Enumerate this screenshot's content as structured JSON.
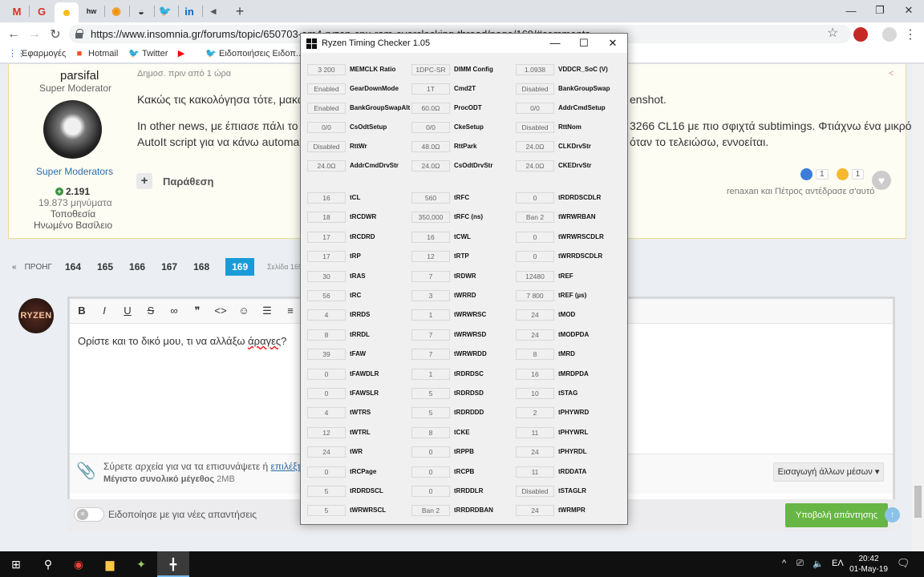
{
  "browser": {
    "url": "https://www.insomnia.gr/forums/topic/650703-am4-ryzen-cpu-ram-overclocking-thread/page/169/#comments",
    "bookmarks": [
      "Εφαρμογές",
      "Hotmail",
      "Twitter",
      "",
      "Ειδοποιήσεις Ειδοπ..."
    ]
  },
  "post": {
    "author": "parsifal",
    "role": "Super Moderator",
    "group": "Super Moderators",
    "reputation": "2.191",
    "posts": "19.873 μηνύματα",
    "location": "Τοποθεσία Ηνωμένο Βασίλειο",
    "date": "Δημοσ. πριν από 1 ώρα",
    "line1a": "Κακώς τις κακολόγησα τότε, μακάρ",
    "line1b": "enshot.",
    "line2a": "In other news, με έπιασε πάλι το μικ",
    "line2b": "3266 CL16 με πιο σφιχτά subtimings. Φτιάχνω ένα μικρό",
    "line3a": "AutoIt script για να κάνω automate p",
    "line3b": "όταν το τελειώσω, εννοείται.",
    "quote": "Παράθεση",
    "reaction1": "1",
    "reaction2": "1",
    "reacted_by": "renaxan και Πέτρος αντέδρασε σ'αυτό"
  },
  "pagination": {
    "prev": "ΠΡΟΗΓ",
    "pages": [
      "164",
      "165",
      "166",
      "167",
      "168"
    ],
    "current": "169",
    "info": "Σελίδα 169 απο"
  },
  "editor": {
    "avatar_text": "RYZEN",
    "text_before": "Ορίστε και το δικό μου, τι να αλλάξω ",
    "text_err": "άραγες",
    "text_after": "?",
    "attach_text": "Σύρετε αρχεία για να τα επισυνάψετε ή ",
    "attach_link": "επιλέξτε",
    "attach_max_label": "Μέγιστο συνολικό μέγεθος",
    "attach_max_value": "2MB",
    "media_button": "Εισαγωγή άλλων μέσων ▾",
    "notify": "Ειδοποίησε με για νέες απαντήσεις",
    "submit": "Υποβολή απάντησης"
  },
  "dialog": {
    "title": "Ryzen Timing Checker 1.05",
    "top": [
      [
        {
          "v": "3 200",
          "l": "MEMCLK Ratio"
        },
        {
          "v": "1DPC-SR",
          "l": "DIMM Config"
        },
        {
          "v": "1.0938",
          "l": "VDDCR_SoC (V)"
        }
      ],
      [
        {
          "v": "Enabled",
          "l": "GearDownMode"
        },
        {
          "v": "1T",
          "l": "Cmd2T"
        },
        {
          "v": "Disabled",
          "l": "BankGroupSwap"
        }
      ],
      [
        {
          "v": "Enabled",
          "l": "BankGroupSwapAlt"
        },
        {
          "v": "60.0Ω",
          "l": "ProcODT"
        },
        {
          "v": "0/0",
          "l": "AddrCmdSetup"
        }
      ],
      [
        {
          "v": "0/0",
          "l": "CsOdtSetup"
        },
        {
          "v": "0/0",
          "l": "CkeSetup"
        },
        {
          "v": "Disabled",
          "l": "RttNom"
        }
      ],
      [
        {
          "v": "Disabled",
          "l": "RttWr"
        },
        {
          "v": "48.0Ω",
          "l": "RttPark"
        },
        {
          "v": "24.0Ω",
          "l": "CLKDrvStr"
        }
      ],
      [
        {
          "v": "24.0Ω",
          "l": "AddrCmdDrvStr"
        },
        {
          "v": "24.0Ω",
          "l": "CsOdtDrvStr"
        },
        {
          "v": "24.0Ω",
          "l": "CKEDrvStr"
        }
      ]
    ],
    "timings": [
      [
        {
          "v": "16",
          "l": "tCL"
        },
        {
          "v": "560",
          "l": "tRFC"
        },
        {
          "v": "0",
          "l": "tRDRDSCDLR"
        }
      ],
      [
        {
          "v": "18",
          "l": "tRCDWR"
        },
        {
          "v": "350,000",
          "l": "tRFC (ns)"
        },
        {
          "v": "Ban 2",
          "l": "tWRWRBAN"
        }
      ],
      [
        {
          "v": "17",
          "l": "tRCDRD"
        },
        {
          "v": "16",
          "l": "tCWL"
        },
        {
          "v": "0",
          "l": "tWRWRSCDLR"
        }
      ],
      [
        {
          "v": "17",
          "l": "tRP"
        },
        {
          "v": "12",
          "l": "tRTP"
        },
        {
          "v": "0",
          "l": "tWRRDSCDLR"
        }
      ],
      [
        {
          "v": "30",
          "l": "tRAS"
        },
        {
          "v": "7",
          "l": "tRDWR"
        },
        {
          "v": "12480",
          "l": "tREF"
        }
      ],
      [
        {
          "v": "56",
          "l": "tRC"
        },
        {
          "v": "3",
          "l": "tWRRD"
        },
        {
          "v": "7 800",
          "l": "tREF (µs)"
        }
      ],
      [
        {
          "v": "4",
          "l": "tRRDS"
        },
        {
          "v": "1",
          "l": "tWRWRSC"
        },
        {
          "v": "24",
          "l": "tMOD"
        }
      ],
      [
        {
          "v": "8",
          "l": "tRRDL"
        },
        {
          "v": "7",
          "l": "tWRWRSD"
        },
        {
          "v": "24",
          "l": "tMODPDA"
        }
      ],
      [
        {
          "v": "39",
          "l": "tFAW"
        },
        {
          "v": "7",
          "l": "tWRWRDD"
        },
        {
          "v": "8",
          "l": "tMRD"
        }
      ],
      [
        {
          "v": "0",
          "l": "tFAWDLR"
        },
        {
          "v": "1",
          "l": "tRDRDSC"
        },
        {
          "v": "16",
          "l": "tMRDPDA"
        }
      ],
      [
        {
          "v": "0",
          "l": "tFAWSLR"
        },
        {
          "v": "5",
          "l": "tRDRDSD"
        },
        {
          "v": "10",
          "l": "tSTAG"
        }
      ],
      [
        {
          "v": "4",
          "l": "tWTRS"
        },
        {
          "v": "5",
          "l": "tRDRDDD"
        },
        {
          "v": "2",
          "l": "tPHYWRD"
        }
      ],
      [
        {
          "v": "12",
          "l": "tWTRL"
        },
        {
          "v": "8",
          "l": "tCKE"
        },
        {
          "v": "11",
          "l": "tPHYWRL"
        }
      ],
      [
        {
          "v": "24",
          "l": "tWR"
        },
        {
          "v": "0",
          "l": "tRPPB"
        },
        {
          "v": "24",
          "l": "tPHYRDL"
        }
      ],
      [
        {
          "v": "0",
          "l": "tRCPage"
        },
        {
          "v": "0",
          "l": "tRCPB"
        },
        {
          "v": "11",
          "l": "tRDDATA"
        }
      ],
      [
        {
          "v": "5",
          "l": "tRDRDSCL"
        },
        {
          "v": "0",
          "l": "tRRDDLR"
        },
        {
          "v": "Disabled",
          "l": "tSTAGLR"
        }
      ],
      [
        {
          "v": "5",
          "l": "tWRWRSCL"
        },
        {
          "v": "Ban 2",
          "l": "tRRDRDBAN"
        },
        {
          "v": "24",
          "l": "tWRMPR"
        }
      ]
    ]
  },
  "taskbar": {
    "lang": "ΕΛ",
    "time": "20:42",
    "date": "01-May-19"
  }
}
